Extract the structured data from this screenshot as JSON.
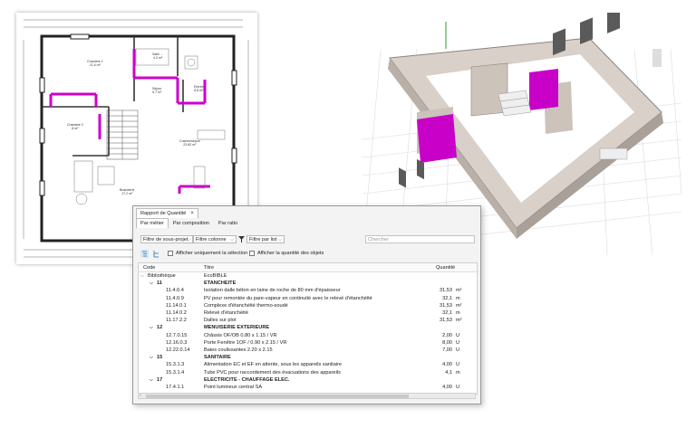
{
  "floorplan": {
    "rooms": [
      {
        "name": "Chambre 1",
        "area": "11.6 m²"
      },
      {
        "name": "Salle ...",
        "area": "4.3 m²"
      },
      {
        "name": "Séjour",
        "area": "5.7 m²"
      },
      {
        "name": "Entrée",
        "area": "8.8 m²"
      },
      {
        "name": "Chambre 2",
        "area": "8 m²"
      },
      {
        "name": "Cuisine/séjour",
        "area": "23.82 m²"
      },
      {
        "name": "Buanderie",
        "area": "17.2 m²"
      }
    ]
  },
  "panel": {
    "window_title": "Rapport de Quantité",
    "close_glyph": "×",
    "tabs": [
      "Par métier",
      "Par composition",
      "Par ratio"
    ],
    "filters": {
      "subproject": "Filtre de sous-projet",
      "column": "Filtre colonne",
      "list": "Filtre par list",
      "search_placeholder": "Chercher"
    },
    "options": {
      "only_selection": "Afficher uniquement la sélection",
      "show_quantity": "Afficher la quantité des objets"
    },
    "columns": {
      "code": "Code",
      "title": "Titre",
      "quantity": "Quantité"
    },
    "rows": [
      {
        "level": 0,
        "code": "Bibliothèque",
        "title": "EcoBIBLE",
        "qty": "",
        "unit": "",
        "group": true
      },
      {
        "level": 1,
        "code": "11",
        "title": "ETANCHEITE",
        "qty": "",
        "unit": "",
        "group": true
      },
      {
        "level": 2,
        "code": "11.4.0.4",
        "title": "Isolation dalle béton en laine de roche de 80 mm d'épaisseur",
        "qty": "31,53",
        "unit": "m²"
      },
      {
        "level": 2,
        "code": "11.4.0.9",
        "title": "PV pour remontée du pare-vapeur en continuité avec le relevé d'étanchéité",
        "qty": "32,1",
        "unit": "m"
      },
      {
        "level": 2,
        "code": "11.14.0.1",
        "title": "Complexe d'étanchéité thermo-soudé",
        "qty": "31,53",
        "unit": "m²"
      },
      {
        "level": 2,
        "code": "11.14.0.2",
        "title": "Relevé d'étanchéité",
        "qty": "32,1",
        "unit": "m"
      },
      {
        "level": 2,
        "code": "11.17.2.2",
        "title": "Dalles sur plot",
        "qty": "31,53",
        "unit": "m²"
      },
      {
        "level": 1,
        "code": "12",
        "title": "MENUISERIE EXTERIEURE",
        "qty": "",
        "unit": "",
        "group": true
      },
      {
        "level": 2,
        "code": "12.7.0.15",
        "title": "Châssis OF/OB 0.80 x 1.15 / VR",
        "qty": "2,00",
        "unit": "U"
      },
      {
        "level": 2,
        "code": "12.16.0.3",
        "title": "Porte Fenêtre 1OF / 0.90 x 2.15 / VR",
        "qty": "8,00",
        "unit": "U"
      },
      {
        "level": 2,
        "code": "12.22.0.14",
        "title": "Baies coulissantes 2.20 x 2.15",
        "qty": "7,00",
        "unit": "U"
      },
      {
        "level": 1,
        "code": "15",
        "title": "SANITAIRE",
        "qty": "",
        "unit": "",
        "group": true
      },
      {
        "level": 2,
        "code": "15.3.1.3",
        "title": "Alimentation EC et EF en attente, sous les appareils sanitaire",
        "qty": "4,00",
        "unit": "U"
      },
      {
        "level": 2,
        "code": "15.3.1.4",
        "title": "Tube PVC pour raccordement des évacuations des appareils",
        "qty": "4,1",
        "unit": "m"
      },
      {
        "level": 1,
        "code": "17",
        "title": "ELECTRICITE - CHAUFFAGE ELEC.",
        "qty": "",
        "unit": "",
        "group": true
      },
      {
        "level": 2,
        "code": "17.4.1.1",
        "title": "Point lumineux central SA",
        "qty": "4,00",
        "unit": "U"
      }
    ]
  },
  "colors": {
    "accent_magenta": "#cc00cc",
    "wall_3d": "#ddd5ce",
    "grid_floor": "#e9e9e9"
  }
}
